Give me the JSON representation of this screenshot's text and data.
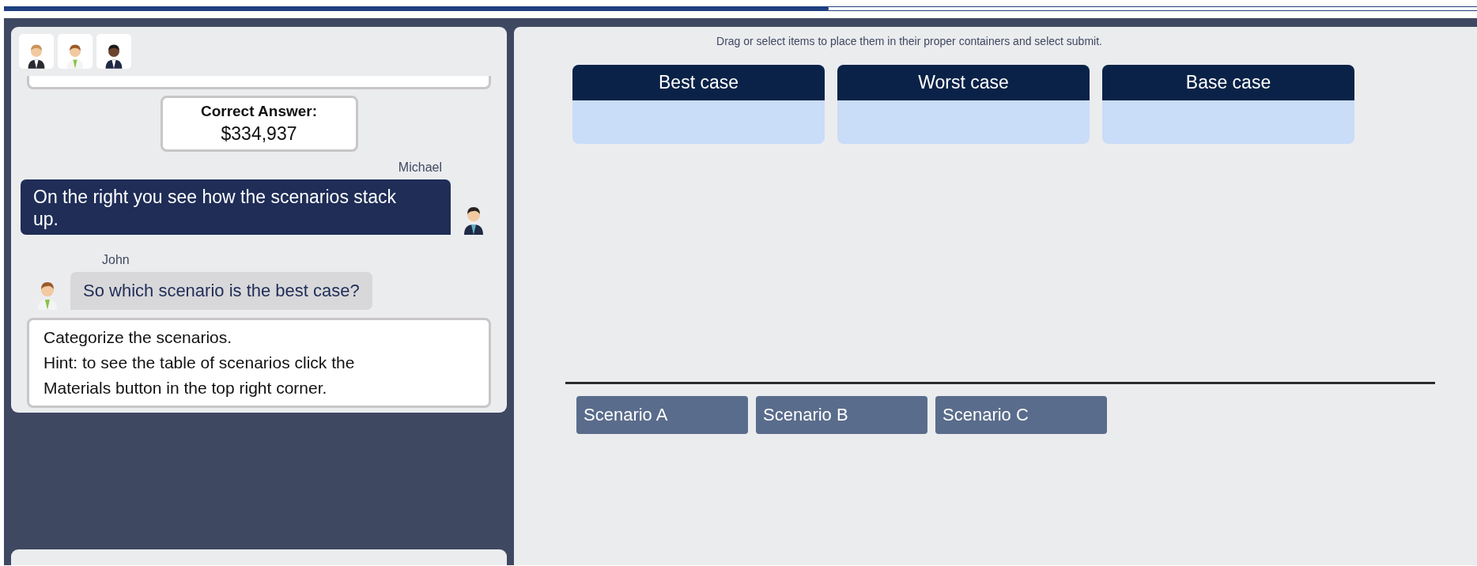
{
  "progress": {
    "level": 0.56
  },
  "chat": [
    {
      "kind": "answer",
      "title": "Correct Answer:",
      "value": "$334,937"
    },
    {
      "kind": "received",
      "speaker": "Michael",
      "text": "On the right you see how the scenarios stack up."
    },
    {
      "kind": "sent",
      "speaker": "John",
      "text": "So which scenario is the best case?"
    },
    {
      "kind": "prompt",
      "lines": [
        "Categorize the scenarios.",
        "Hint: to see the table of scenarios click the Materials button in the top right corner."
      ]
    }
  ],
  "instruction": "Drag or select items to place them in their proper containers and select submit.",
  "containers": [
    {
      "label": "Best case"
    },
    {
      "label": "Worst case"
    },
    {
      "label": "Base case"
    }
  ],
  "items": [
    {
      "label": "Scenario A"
    },
    {
      "label": "Scenario B"
    },
    {
      "label": "Scenario C"
    }
  ]
}
